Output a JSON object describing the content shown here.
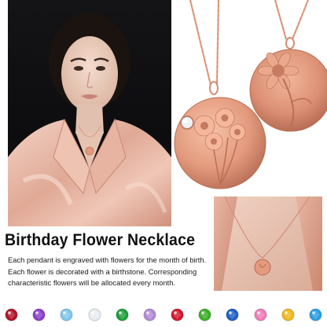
{
  "title": "Birthday Flower Necklace",
  "description": "Each pendant is engraved with flowers for the month of birth. Each flower is decorated with a birthstone. Corresponding characteristic flowers will be allocated every month.",
  "colors": {
    "rose_gold": "#e39a7d",
    "rose_gold_dark": "#c97a5f",
    "silk_blouse": "#e6b8a8",
    "background_dark": "#121214"
  },
  "birthstones": [
    {
      "name": "garnet-gem",
      "color": "#b0142a"
    },
    {
      "name": "amethyst-gem",
      "color": "#8a3fc8"
    },
    {
      "name": "aquamarine-gem",
      "color": "#7fc6ea"
    },
    {
      "name": "diamond-gem",
      "color": "#e6eef3"
    },
    {
      "name": "emerald-gem",
      "color": "#1e9e3c"
    },
    {
      "name": "alexandrite-gem",
      "color": "#b08ad6"
    },
    {
      "name": "ruby-gem",
      "color": "#d4162c"
    },
    {
      "name": "peridot-gem",
      "color": "#3cae28"
    },
    {
      "name": "sapphire-gem",
      "color": "#1d5fc4"
    },
    {
      "name": "tourmaline-gem",
      "color": "#f07ab8"
    },
    {
      "name": "citrine-gem",
      "color": "#f0b81a"
    },
    {
      "name": "blue-topaz-gem",
      "color": "#2a9ee0"
    }
  ]
}
